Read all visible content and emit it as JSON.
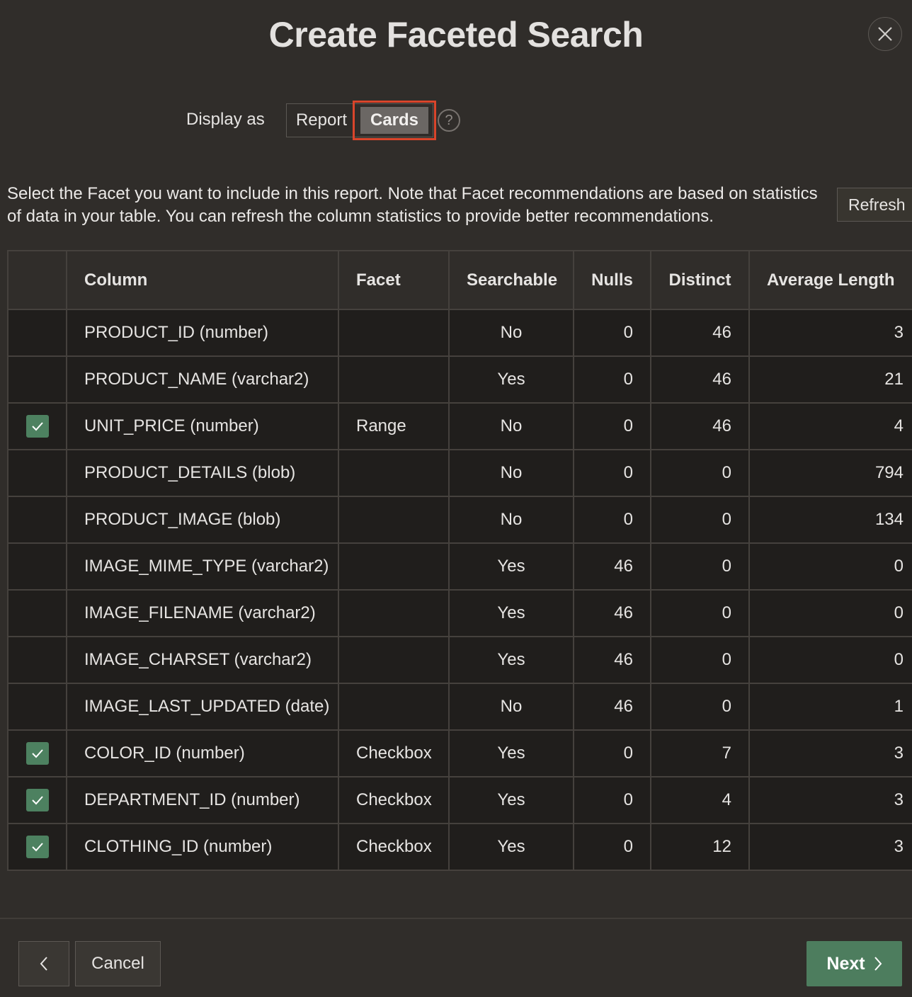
{
  "dialog": {
    "title": "Create Faceted Search"
  },
  "display_as": {
    "label": "Display as",
    "options": [
      "Report",
      "Cards"
    ],
    "selected": "Cards",
    "help_icon": "question-circle-icon"
  },
  "description": "Select the Facet you want to include in this report. Note that Facet recommendations are based on statistics of data in your table. You can refresh the column statistics to provide better recommendations.",
  "refresh_label": "Refresh",
  "table": {
    "headers": [
      "",
      "Column",
      "Facet",
      "Searchable",
      "Nulls",
      "Distinct",
      "Average Length"
    ],
    "rows": [
      {
        "checked": false,
        "column": "PRODUCT_ID (number)",
        "facet": "",
        "searchable": "No",
        "nulls": "0",
        "distinct": "46",
        "avg_length": "3"
      },
      {
        "checked": false,
        "column": "PRODUCT_NAME (varchar2)",
        "facet": "",
        "searchable": "Yes",
        "nulls": "0",
        "distinct": "46",
        "avg_length": "21"
      },
      {
        "checked": true,
        "column": "UNIT_PRICE (number)",
        "facet": "Range",
        "searchable": "No",
        "nulls": "0",
        "distinct": "46",
        "avg_length": "4"
      },
      {
        "checked": false,
        "column": "PRODUCT_DETAILS (blob)",
        "facet": "",
        "searchable": "No",
        "nulls": "0",
        "distinct": "0",
        "avg_length": "794"
      },
      {
        "checked": false,
        "column": "PRODUCT_IMAGE (blob)",
        "facet": "",
        "searchable": "No",
        "nulls": "0",
        "distinct": "0",
        "avg_length": "134"
      },
      {
        "checked": false,
        "column": "IMAGE_MIME_TYPE (varchar2)",
        "facet": "",
        "searchable": "Yes",
        "nulls": "46",
        "distinct": "0",
        "avg_length": "0"
      },
      {
        "checked": false,
        "column": "IMAGE_FILENAME (varchar2)",
        "facet": "",
        "searchable": "Yes",
        "nulls": "46",
        "distinct": "0",
        "avg_length": "0"
      },
      {
        "checked": false,
        "column": "IMAGE_CHARSET (varchar2)",
        "facet": "",
        "searchable": "Yes",
        "nulls": "46",
        "distinct": "0",
        "avg_length": "0"
      },
      {
        "checked": false,
        "column": "IMAGE_LAST_UPDATED (date)",
        "facet": "",
        "searchable": "No",
        "nulls": "46",
        "distinct": "0",
        "avg_length": "1"
      },
      {
        "checked": true,
        "column": "COLOR_ID (number)",
        "facet": "Checkbox",
        "searchable": "Yes",
        "nulls": "0",
        "distinct": "7",
        "avg_length": "3"
      },
      {
        "checked": true,
        "column": "DEPARTMENT_ID (number)",
        "facet": "Checkbox",
        "searchable": "Yes",
        "nulls": "0",
        "distinct": "4",
        "avg_length": "3"
      },
      {
        "checked": true,
        "column": "CLOTHING_ID (number)",
        "facet": "Checkbox",
        "searchable": "Yes",
        "nulls": "0",
        "distinct": "12",
        "avg_length": "3"
      }
    ]
  },
  "footer": {
    "previous_icon": "chevron-left-icon",
    "cancel_label": "Cancel",
    "next_label": "Next",
    "next_icon": "chevron-right-icon"
  },
  "colors": {
    "accent_green": "#4d7d5e",
    "highlight_red": "#d9452b"
  }
}
